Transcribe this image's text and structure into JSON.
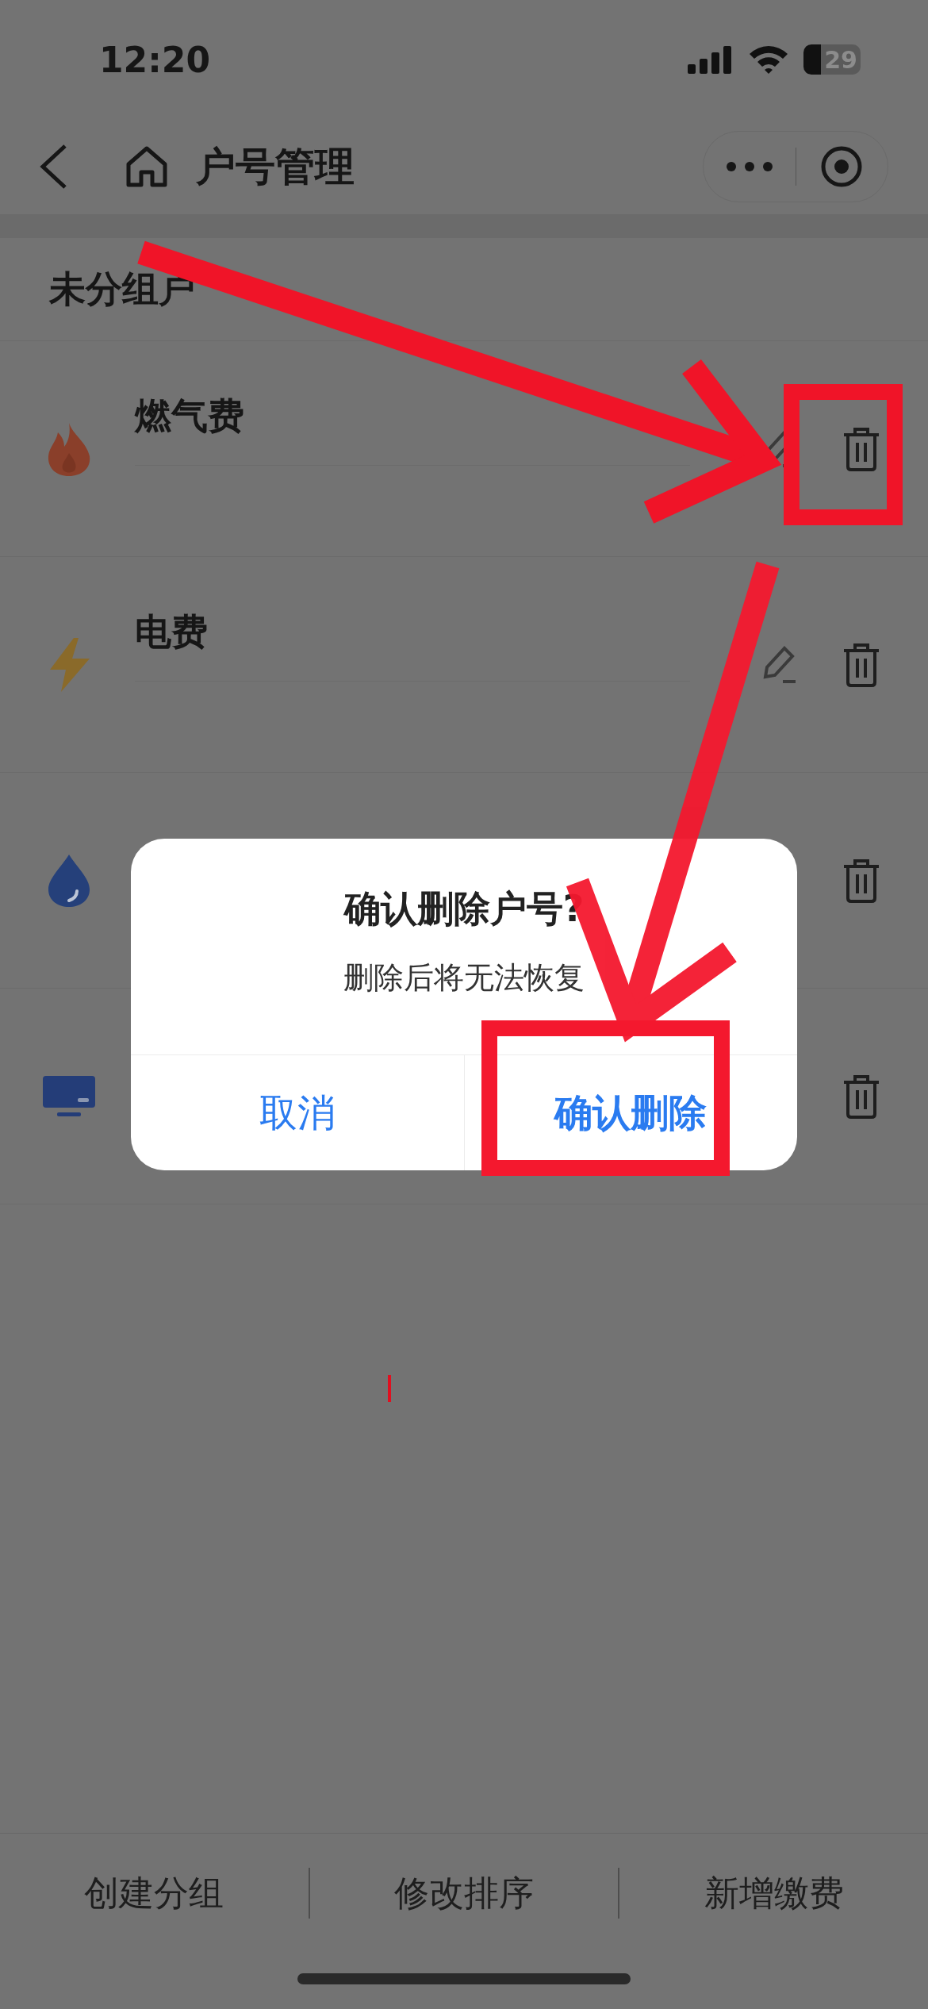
{
  "status_bar": {
    "time": "12:20",
    "battery": "29"
  },
  "nav_bar": {
    "title": "户号管理"
  },
  "section": {
    "title": "未分组户"
  },
  "accounts": [
    {
      "kind": "gas",
      "name": "燃气费"
    },
    {
      "kind": "electricity",
      "name": "电费"
    },
    {
      "kind": "water"
    },
    {
      "kind": "tv"
    }
  ],
  "dialog": {
    "title": "确认删除户号?",
    "message": "删除后将无法恢复",
    "buttons": [
      {
        "kind": "cancel",
        "label": "取消"
      },
      {
        "kind": "confirm",
        "label": "确认删除"
      }
    ]
  },
  "bottom_bar": {
    "buttons": [
      {
        "label": "创建分组"
      },
      {
        "label": "修改排序"
      },
      {
        "label": "新增缴费"
      }
    ]
  }
}
